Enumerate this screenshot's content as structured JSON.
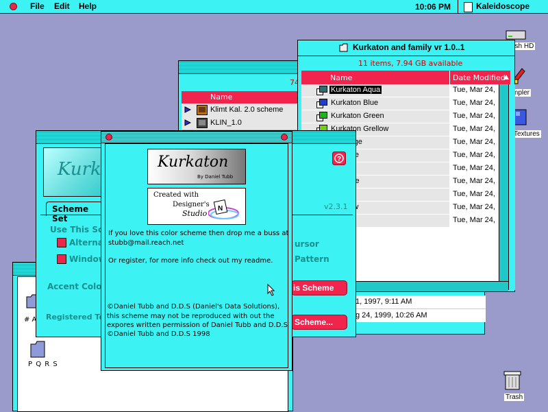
{
  "menubar": {
    "menus": [
      "File",
      "Edit",
      "Help"
    ],
    "clock": "10:06 PM",
    "app": "Kaleidoscope"
  },
  "desktop": {
    "hd_label": "osh HD",
    "sampler_label": "mpler",
    "textures_label": "Textures",
    "trash_label": "Trash"
  },
  "back_finder": {
    "count_partial": "74",
    "column_name": "Name",
    "items": [
      "Klimt Kal. 2.0 scheme",
      "KLIN_1.0"
    ]
  },
  "kurkaton_window": {
    "title": "Kurkaton and family vr 1.0..1",
    "status": "11 items, 7.94 GB available",
    "col_name": "Name",
    "col_date": "Date Modified",
    "rows": [
      {
        "name": "Kurkaton Aqua",
        "date": "Tue, Mar 24,",
        "color": "#2f6f6f"
      },
      {
        "name": "Kurkaton Blue",
        "date": "Tue, Mar 24,",
        "color": "#1f3fc8"
      },
      {
        "name": "Kurkaton Green",
        "date": "Tue, Mar 24,",
        "color": "#1bb51b"
      },
      {
        "name": "Kurkaton Grellow",
        "date": "Tue, Mar 24,",
        "color": "#6fcf1b"
      },
      {
        "name": "n Orange",
        "date": "Tue, Mar 24,",
        "color": ""
      },
      {
        "name": "n Purple",
        "date": "Tue, Mar 24,",
        "color": ""
      },
      {
        "name": "n Red",
        "date": "Tue, Mar 24,",
        "color": ""
      },
      {
        "name": "n Rurple",
        "date": "Tue, Mar 24,",
        "color": ""
      },
      {
        "name": "n Violet",
        "date": "Tue, Mar 24,",
        "color": ""
      },
      {
        "name": "n Yellow",
        "date": "Tue, Mar 24,",
        "color": ""
      },
      {
        "name": "",
        "date": "Tue, Mar 24,",
        "color": ""
      }
    ]
  },
  "lower_finder": {
    "date1": "1, 1997, 9:11 AM",
    "date2": "g 24, 1999, 10:26 AM"
  },
  "kaleidoscope_cp": {
    "logo_partial": "Kurk",
    "tab_label": "Scheme Set",
    "group_label": "Use This Sch",
    "option1": "Alterna",
    "option2": "Window",
    "accent_label": "Accent Color",
    "registered_label": "Registered To:",
    "version": "v2.3.1",
    "right_text1": "ursor",
    "right_text2": "Pattern",
    "btn_scheme": "is Scheme",
    "btn_scheme_more": "Scheme..."
  },
  "left_finder": {
    "icon1_label": "# A",
    "icon2_label": "P Q R S"
  },
  "about_dialog": {
    "logo_title": "Kurkaton",
    "logo_sub": "By Daniel Tubb",
    "created_with": "Created with",
    "designers": "Designer's",
    "studio": "Studio",
    "msg1": "If you love this color scheme then drop me a buss at",
    "msg2": "stubb@mail.reach.net",
    "msg3": "Or register, for more info check out my readme.",
    "copy1": "©Daniel Tubb and D.D.S (Daniel's Data Solutions),",
    "copy2": "this scheme may not be reproduced with out the",
    "copy3": "expores written permission of Daniel Tubb and D.D.S",
    "copy4": "©Daniel Tubb and D.D.S 1998"
  }
}
